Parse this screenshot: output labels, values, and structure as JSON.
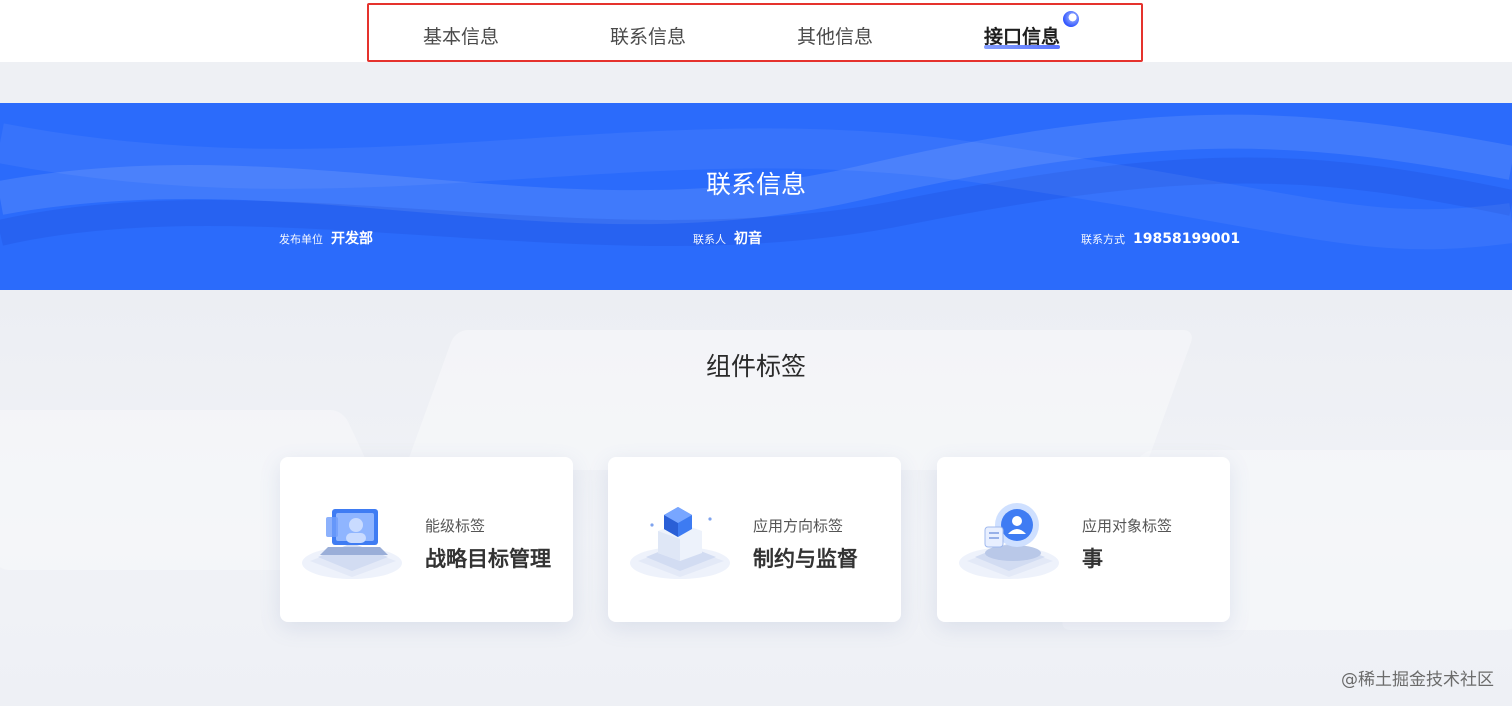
{
  "tabs": [
    {
      "label": "基本信息"
    },
    {
      "label": "联系信息"
    },
    {
      "label": "其他信息"
    },
    {
      "label": "接口信息",
      "active": true
    }
  ],
  "banner": {
    "title": "联系信息",
    "items": [
      {
        "key": "发布单位",
        "value": "开发部"
      },
      {
        "key": "联系人",
        "value": "初音"
      },
      {
        "key": "联系方式",
        "value": "19858199001"
      }
    ]
  },
  "section": {
    "title": "组件标签",
    "cards": [
      {
        "label": "能级标签",
        "value": "战略目标管理",
        "icon": "laptop-user-icon"
      },
      {
        "label": "应用方向标签",
        "value": "制约与监督",
        "icon": "cube-box-icon"
      },
      {
        "label": "应用对象标签",
        "value": "事",
        "icon": "user-badge-icon"
      }
    ]
  },
  "watermark": "@稀土掘金技术社区",
  "colors": {
    "banner": "#2b6bfb",
    "active_tab_frame": "#e5322d",
    "accent": "#3a5bff"
  }
}
